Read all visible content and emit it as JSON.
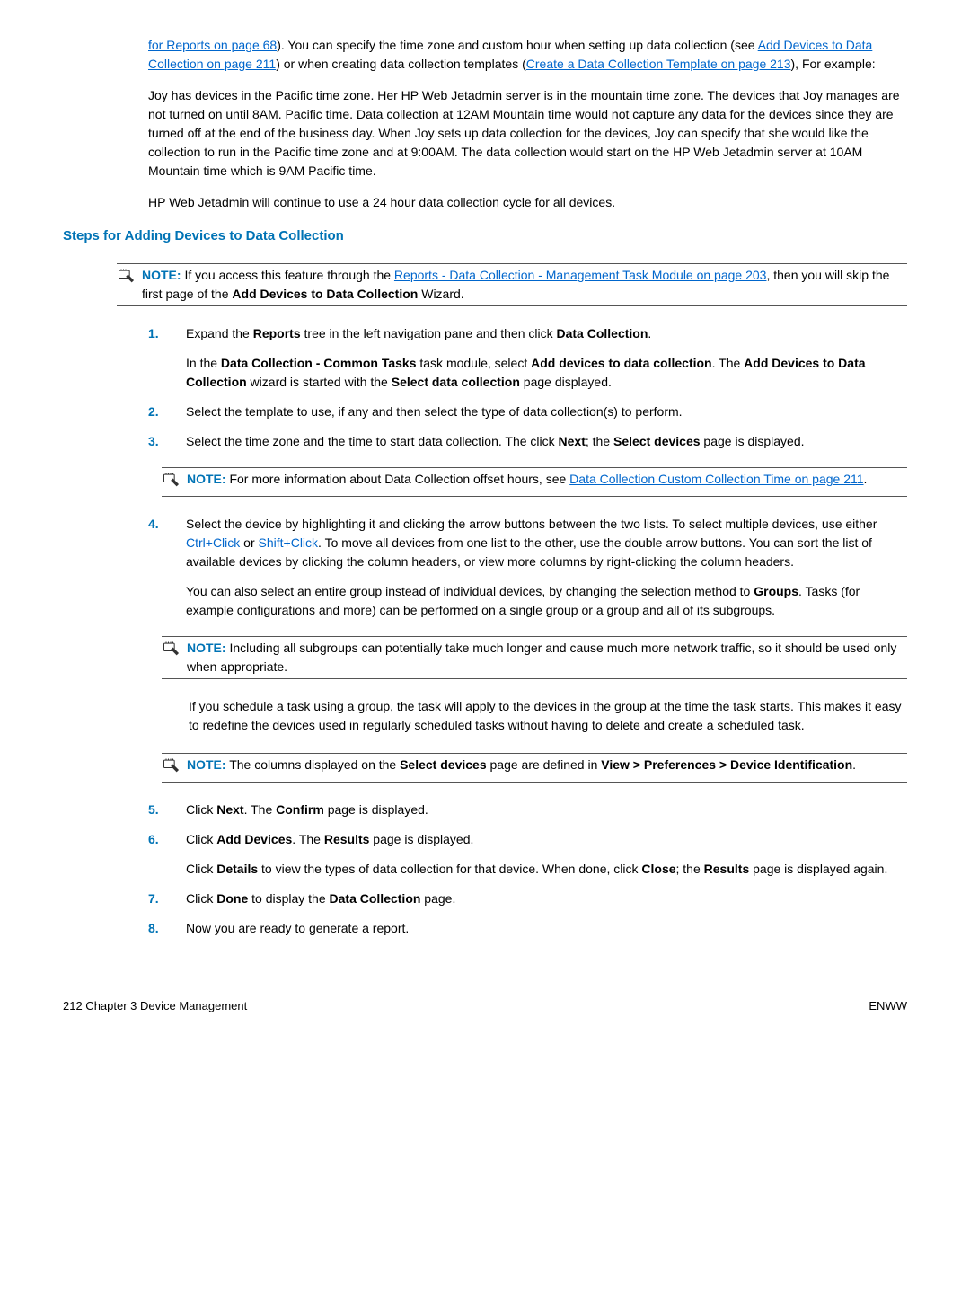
{
  "intro": {
    "link1": "for Reports on page 68",
    "text1": "). You can specify the time zone and custom hour when setting up data collection (see ",
    "link2": "Add Devices to Data Collection on page 211",
    "text2": ") or when creating data collection templates (",
    "link3": "Create a Data Collection Template on page 213",
    "text3": "), For example:"
  },
  "example": "Joy has devices in the Pacific time zone. Her HP Web Jetadmin server is in the mountain time zone. The devices that Joy manages are not turned on until 8AM. Pacific time. Data collection at 12AM Mountain time would not capture any data for the devices since they are turned off at the end of the business day. When Joy sets up data collection for the devices, Joy can specify that she would like the collection to run in the Pacific time zone and at 9:00AM. The data collection would start on the HP Web Jetadmin server at 10AM Mountain time which is 9AM Pacific time.",
  "continue": "HP Web Jetadmin will continue to use a 24 hour data collection cycle for all devices.",
  "heading": "Steps for Adding Devices to Data Collection",
  "note1": {
    "label": "NOTE:",
    "pre": "If you access this feature through the ",
    "link": "Reports - Data Collection - Management Task Module on page 203",
    "post": ", then you will skip the first page of the ",
    "bold": "Add Devices to Data Collection",
    "tail": " Wizard."
  },
  "steps": {
    "s1": {
      "num": "1.",
      "a": "Expand the ",
      "b1": "Reports",
      "c": " tree in the left navigation pane and then click ",
      "b2": "Data Collection",
      "d": ".",
      "p2a": "In the ",
      "p2b1": "Data Collection - Common Tasks",
      "p2c": " task module, select ",
      "p2b2": "Add devices to data collection",
      "p2d": ". The ",
      "p2b3": "Add Devices to Data Collection",
      "p2e": " wizard is started with the ",
      "p2b4": "Select data collection",
      "p2f": " page displayed."
    },
    "s2": {
      "num": "2.",
      "text": "Select the template to use, if any and then select the type of data collection(s) to perform."
    },
    "s3": {
      "num": "3.",
      "a": "Select the time zone and the time to start data collection. The click ",
      "b1": "Next",
      "c": "; the ",
      "b2": "Select devices",
      "d": " page is displayed."
    },
    "note2": {
      "label": "NOTE:",
      "pre": "For more information about Data Collection offset hours, see ",
      "link": "Data Collection Custom Collection Time on page 211",
      "post": "."
    },
    "s4": {
      "num": "4.",
      "p1a": "Select the device by highlighting it and clicking the arrow buttons between the two lists. To select multiple devices, use either ",
      "k1": "Ctrl+Click",
      "p1b": " or ",
      "k2": "Shift+Click",
      "p1c": ". To move all devices from one list to the other, use the double arrow buttons. You can sort the list of available devices by clicking the column headers, or view more columns by right-clicking the column headers.",
      "p2a": "You can also select an entire group instead of individual devices, by changing the selection method to ",
      "p2b": "Groups",
      "p2c": ". Tasks (for example configurations and more) can be performed on a single group or a group and all of its subgroups."
    },
    "note3": {
      "label": "NOTE:",
      "text": "Including all subgroups can potentially take much longer and cause much more network traffic, so it should be used only when appropriate."
    },
    "s4b": {
      "p1": "If you schedule a task using a group, the task will apply to the devices in the group at the time the task starts. This makes it easy to redefine the devices used in regularly scheduled tasks without having to delete and create a scheduled task."
    },
    "note4": {
      "label": "NOTE:",
      "a": "The columns displayed on the ",
      "b1": "Select devices",
      "c": " page are defined in ",
      "b2": "View > Preferences > Device Identification",
      "d": "."
    },
    "s5": {
      "num": "5.",
      "a": "Click ",
      "b1": "Next",
      "c": ". The ",
      "b2": "Confirm",
      "d": " page is displayed."
    },
    "s6": {
      "num": "6.",
      "a": "Click ",
      "b1": "Add Devices",
      "c": ". The ",
      "b2": "Results",
      "d": " page is displayed.",
      "p2a": "Click ",
      "p2b1": "Details",
      "p2c": " to view the types of data collection for that device. When done, click ",
      "p2b2": "Close",
      "p2d": "; the ",
      "p2b3": "Results",
      "p2e": " page is displayed again."
    },
    "s7": {
      "num": "7.",
      "a": "Click ",
      "b1": "Done",
      "c": " to display the ",
      "b2": "Data Collection",
      "d": " page."
    },
    "s8": {
      "num": "8.",
      "text": "Now you are ready to generate a report."
    }
  },
  "footer": {
    "left": "212   Chapter 3   Device Management",
    "right": "ENWW"
  }
}
